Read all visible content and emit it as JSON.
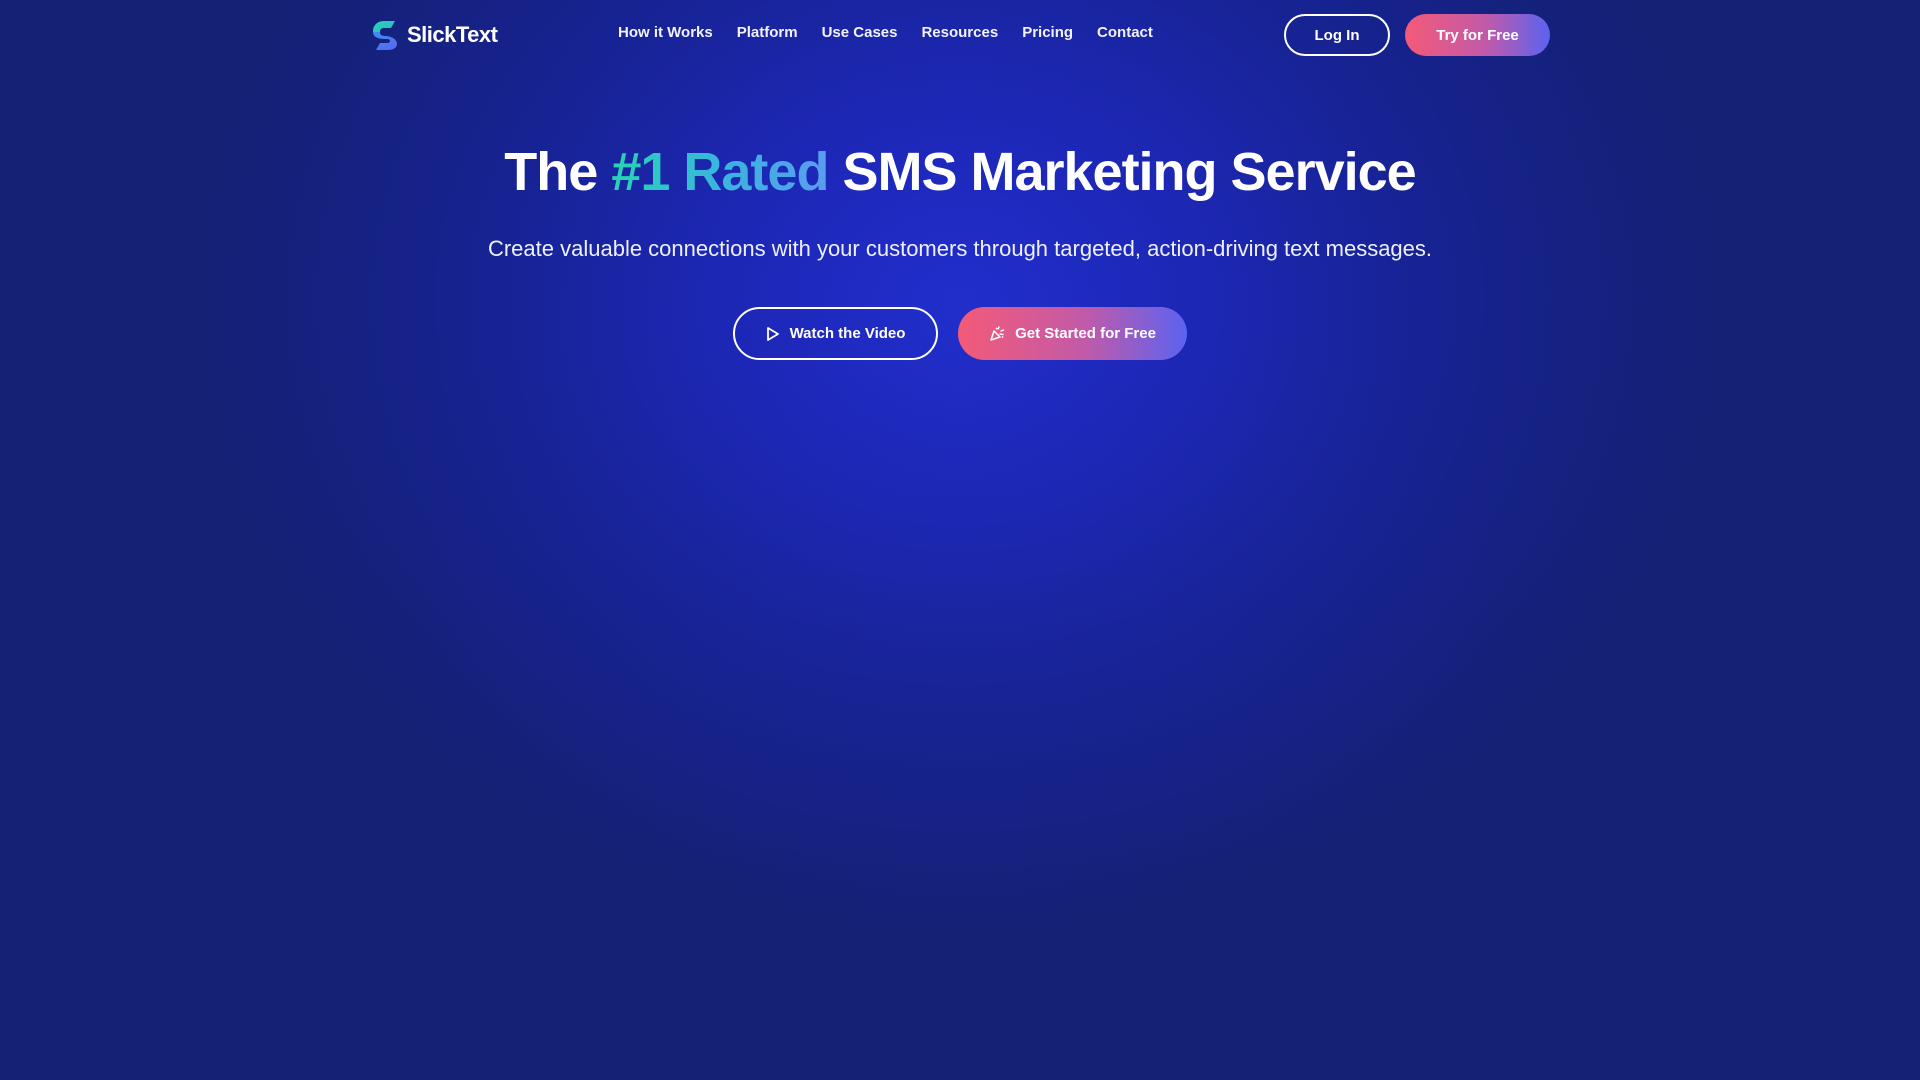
{
  "brand": {
    "name": "SlickText",
    "logo_icon": "slicktext-logo-icon",
    "logo_colors": [
      "#27d3b4",
      "#4a7cf0"
    ]
  },
  "nav": {
    "links": [
      "How it Works",
      "Platform",
      "Use Cases",
      "Resources",
      "Pricing",
      "Contact"
    ],
    "login_label": "Log In",
    "try_label": "Try for Free"
  },
  "hero": {
    "title_prefix": "The",
    "title_accent": "#1 Rated",
    "title_suffix": "SMS Marketing Service",
    "subtitle": "Create valuable connections with your customers through targeted, action-driving text messages.",
    "watch_label": "Watch the Video",
    "watch_icon": "play-icon",
    "start_label": "Get Started for Free",
    "start_icon": "party-popper-icon"
  },
  "colors": {
    "background": "#1a24b0",
    "accent_gradient_start": "#f45a78",
    "accent_gradient_end": "#5b63f0",
    "title_accent_start": "#27d3b4",
    "title_accent_end": "#5a9cf0"
  }
}
